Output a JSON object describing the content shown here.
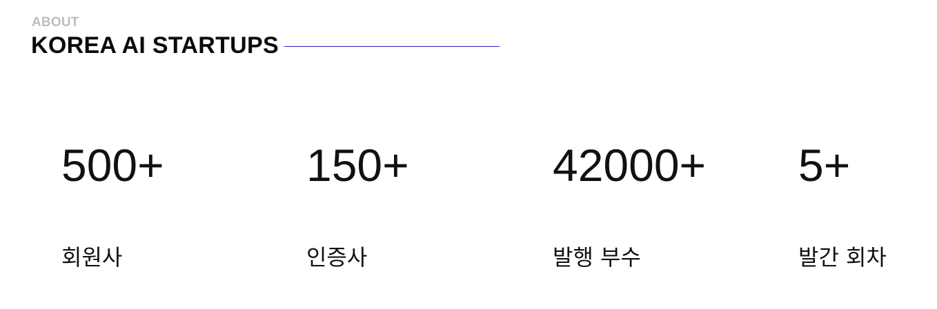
{
  "section": {
    "eyebrow": "ABOUT",
    "title": "KOREA AI STARTUPS"
  },
  "stats": [
    {
      "value": "500+",
      "label": "회원사"
    },
    {
      "value": "150+",
      "label": "인증사"
    },
    {
      "value": "42000+",
      "label": "발행 부수"
    },
    {
      "value": "5+",
      "label": "발간 회차"
    }
  ],
  "colors": {
    "accent_rule": "#2a1fc4",
    "eyebrow": "#bdbdbd",
    "text": "#111111"
  }
}
